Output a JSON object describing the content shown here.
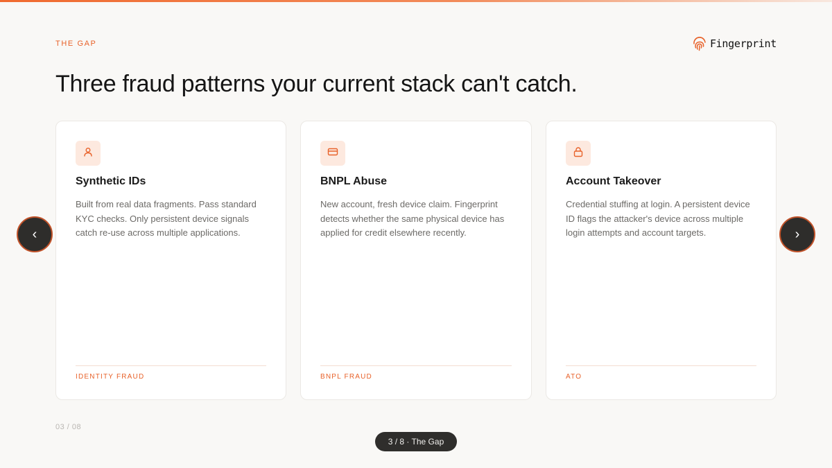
{
  "header": {
    "eyebrow": "THE GAP",
    "brand": "Fingerprint",
    "headline": "Three fraud patterns your current stack can't catch."
  },
  "cards": [
    {
      "icon": "user-icon",
      "title": "Synthetic IDs",
      "description": "Built from real data fragments. Pass standard KYC checks. Only persistent device signals catch re-use across multiple applications.",
      "tag": "IDENTITY FRAUD"
    },
    {
      "icon": "credit-card-icon",
      "title": "BNPL Abuse",
      "description": "New account, fresh device claim. Fingerprint detects whether the same physical device has applied for credit elsewhere recently.",
      "tag": "BNPL FRAUD"
    },
    {
      "icon": "lock-icon",
      "title": "Account Takeover",
      "description": "Credential stuffing at login. A persistent device ID flags the attacker's device across multiple login attempts and account targets.",
      "tag": "ATO"
    }
  ],
  "navigation": {
    "prev_label": "‹",
    "next_label": "›",
    "page_count": "03 / 08",
    "slide_indicator": "3 / 8 · The Gap"
  },
  "colors": {
    "accent": "#e8622a",
    "background": "#f9f8f6",
    "icon_bg": "#fde9df",
    "nav_bg": "#2e2d2b"
  }
}
